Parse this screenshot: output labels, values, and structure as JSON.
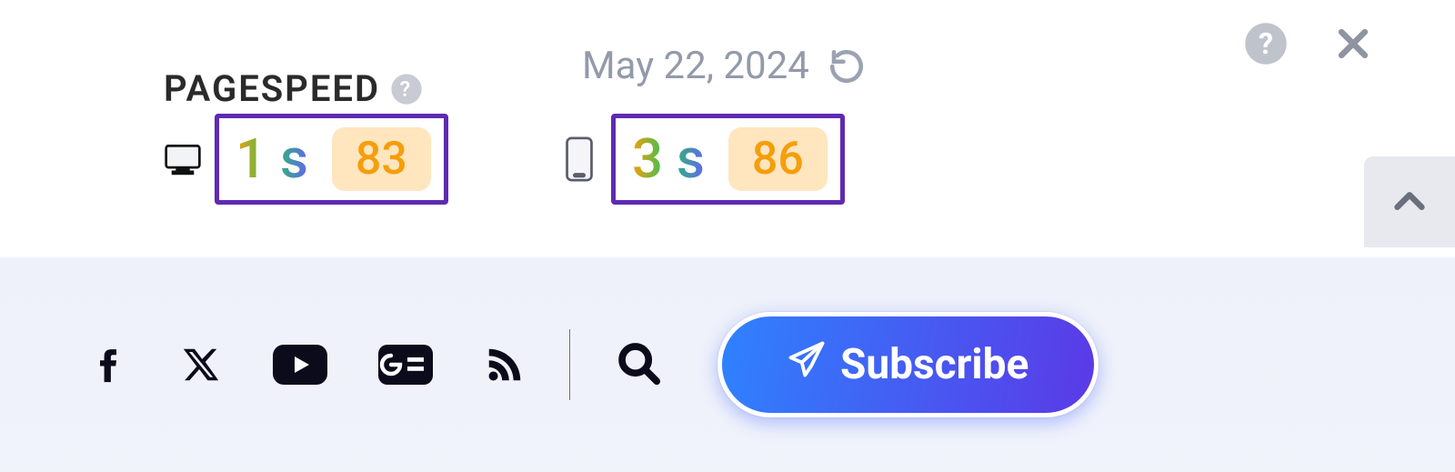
{
  "header": {
    "pagespeed_label": "PAGESPEED",
    "date_label": "May 22, 2024"
  },
  "metrics": {
    "desktop": {
      "time": "1 s",
      "score": "83"
    },
    "mobile": {
      "time": "3 s",
      "score": "86"
    }
  },
  "footer": {
    "subscribe_label": "Subscribe"
  },
  "colors": {
    "box_border": "#5e2ab3",
    "score_bg": "#ffe6bf",
    "score_fg": "#f59e0b",
    "btn_grad_a": "#2e82ff",
    "btn_grad_b": "#5b39e6"
  }
}
